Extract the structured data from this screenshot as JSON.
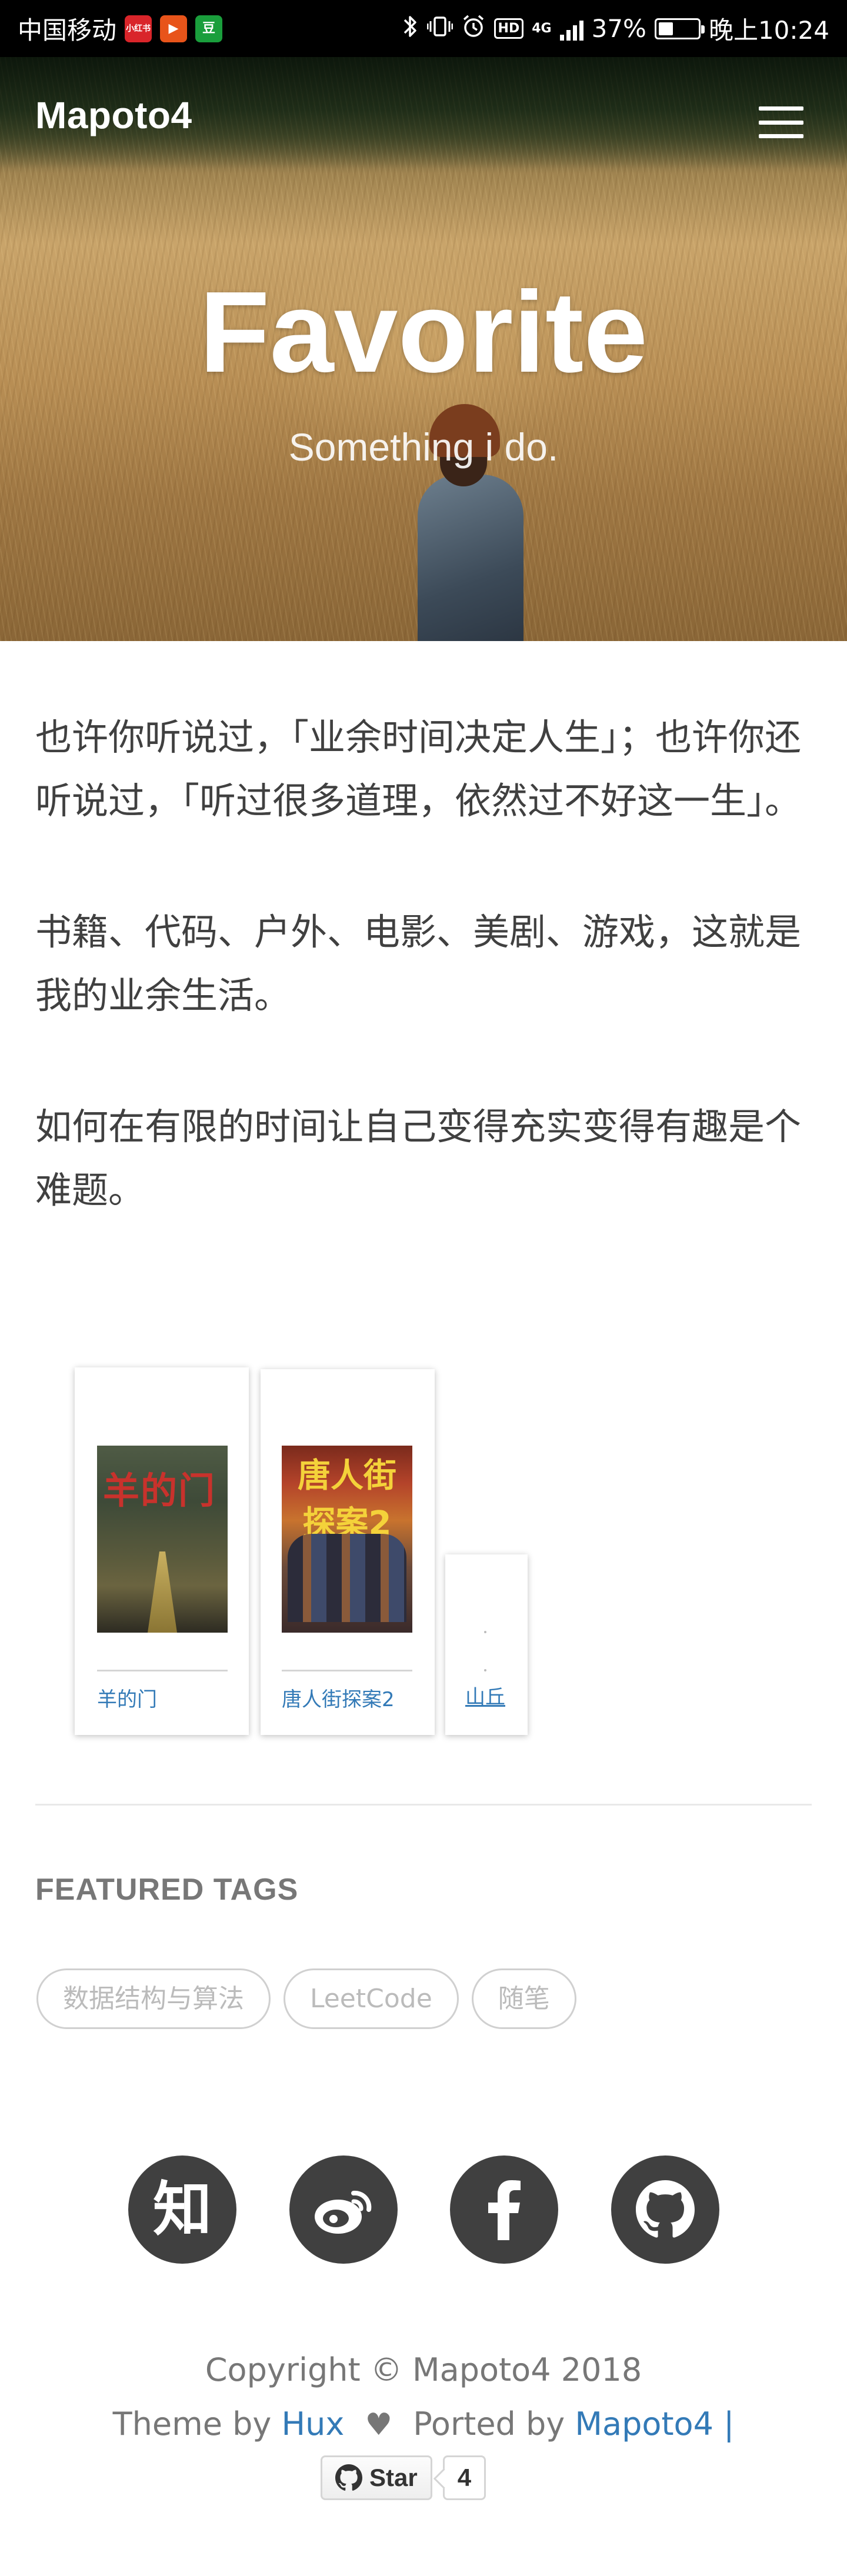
{
  "status_bar": {
    "carrier": "中国移动",
    "battery_text": "37%",
    "battery_level": 0.37,
    "time": "晚上10:24",
    "network": "4G",
    "hd_badge": "HD",
    "app_badges": [
      "小红书",
      "▶",
      "豆"
    ]
  },
  "nav": {
    "brand": "Mapoto4",
    "menu_icon": "hamburger-menu-icon"
  },
  "hero": {
    "title": "Favorite",
    "subtitle": "Something i do."
  },
  "article": {
    "paragraphs": [
      "也许你听说过，「业余时间决定人生」；也许你还听说过，「听过很多道理，依然过不好这一生」。",
      "书籍、代码、户外、电影、美剧、游戏，这就是我的业余生活。",
      "如何在有限的时间让自己变得充实变得有趣是个难题。"
    ]
  },
  "favorites": [
    {
      "title": "羊的门",
      "cover_text": "羊的门"
    },
    {
      "title": "唐人街探案2",
      "cover_text": "唐人街探案2"
    },
    {
      "title": "山丘"
    }
  ],
  "featured_tags": {
    "title": "FEATURED TAGS",
    "tags": [
      "数据结构与算法",
      "LeetCode",
      "随笔"
    ]
  },
  "social": [
    {
      "name": "zhihu",
      "label": "知",
      "icon": "zhihu-icon"
    },
    {
      "name": "weibo",
      "icon": "weibo-icon"
    },
    {
      "name": "facebook",
      "icon": "facebook-icon"
    },
    {
      "name": "github",
      "icon": "github-icon"
    }
  ],
  "footer": {
    "copyright": "Copyright © Mapoto4 2018",
    "theme_prefix": "Theme by",
    "theme_author": "Hux",
    "ported_prefix": "Ported by",
    "ported_author": "Mapoto4",
    "separator": "|",
    "star_label": "Star",
    "star_count": "4"
  },
  "colors": {
    "link": "#337ab7",
    "text": "#404040",
    "muted": "#777777",
    "social_bg": "#404040"
  }
}
